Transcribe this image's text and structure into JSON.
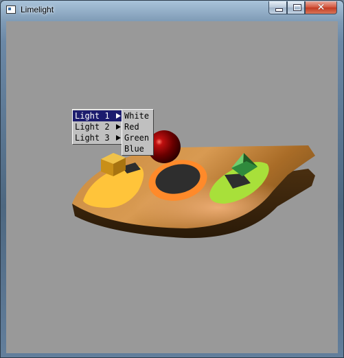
{
  "window": {
    "title": "Limelight"
  },
  "controls": {
    "minimize": "—",
    "maximize": "□",
    "close": "✕"
  },
  "menu": {
    "items": [
      {
        "label": "Light 1",
        "active": true
      },
      {
        "label": "Light 2",
        "active": false
      },
      {
        "label": "Light 3",
        "active": false
      }
    ],
    "submenu": [
      "White",
      "Red",
      "Green",
      "Blue"
    ]
  },
  "colors": {
    "viewport_bg": "#999999",
    "platform": "#b4782e",
    "sphere": "#8a0000",
    "cube": "#d4a21a",
    "pyramid": "#2f8a3c",
    "spot_yellow": "#ffc43a",
    "spot_orange": "#ff8a2a",
    "spot_green": "#a8e03a",
    "menu_highlight": "#1c1c6e"
  },
  "icons": [
    "app-window-icon",
    "minimize-icon",
    "maximize-icon",
    "close-icon",
    "submenu-arrow-icon"
  ]
}
